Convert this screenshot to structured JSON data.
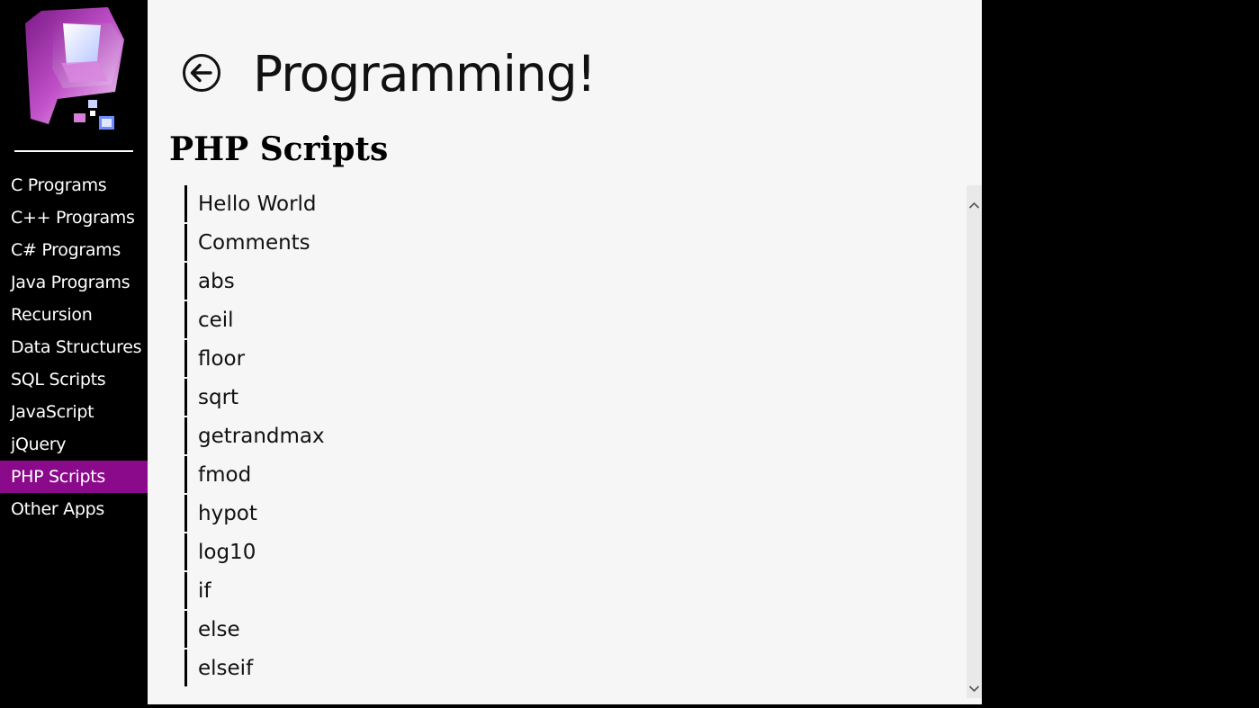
{
  "app": {
    "title": "Programming!",
    "accent_color": "#8b0a8b"
  },
  "header": {
    "back_icon": "back-arrow-circle-icon"
  },
  "sidebar": {
    "logo_icon": "app-logo-icon",
    "items": [
      {
        "label": "C Programs",
        "active": false
      },
      {
        "label": "C++ Programs",
        "active": false
      },
      {
        "label": "C# Programs",
        "active": false
      },
      {
        "label": "Java Programs",
        "active": false
      },
      {
        "label": "Recursion",
        "active": false
      },
      {
        "label": "Data Structures",
        "active": false
      },
      {
        "label": "SQL Scripts",
        "active": false
      },
      {
        "label": "JavaScript",
        "active": false
      },
      {
        "label": "jQuery",
        "active": false
      },
      {
        "label": "PHP Scripts",
        "active": true
      },
      {
        "label": "Other Apps",
        "active": false
      }
    ]
  },
  "main": {
    "section_title": "PHP Scripts",
    "scripts": [
      "Hello World",
      "Comments",
      "abs",
      "ceil",
      "floor",
      "sqrt",
      "getrandmax",
      "fmod",
      "hypot",
      "log10",
      "if",
      "else",
      "elseif"
    ]
  },
  "scrollbar": {
    "up_icon": "chevron-up-icon",
    "down_icon": "chevron-down-icon"
  }
}
